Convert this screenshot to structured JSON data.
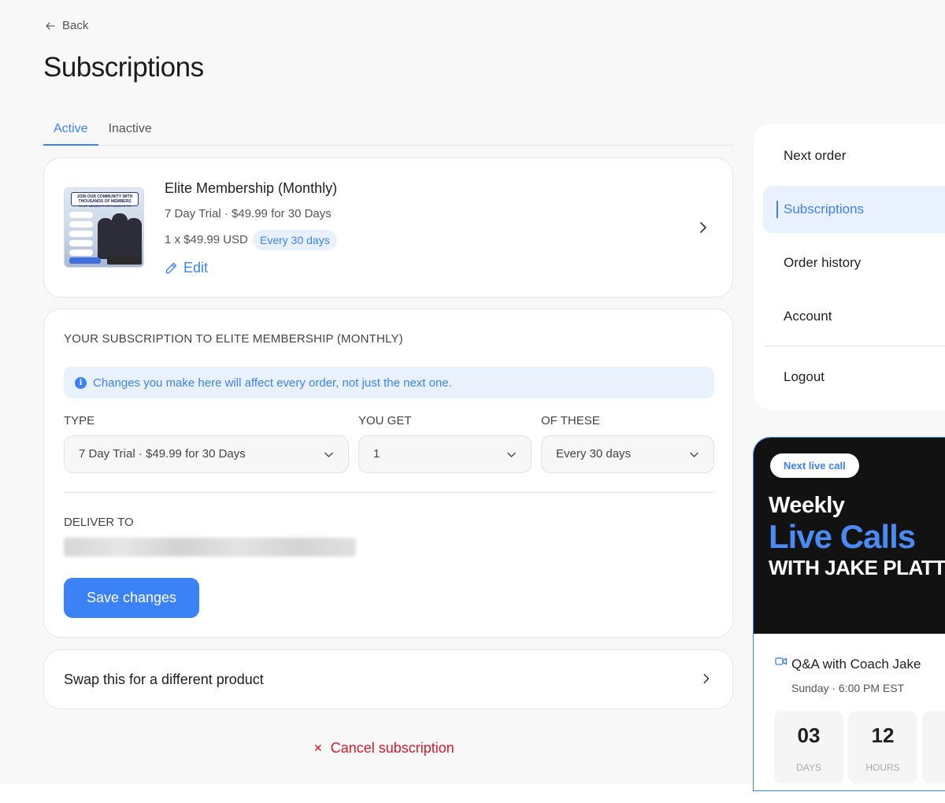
{
  "header": {
    "back_label": "Back",
    "page_title": "Subscriptions"
  },
  "tabs": [
    {
      "label": "Active",
      "active": true
    },
    {
      "label": "Inactive",
      "active": false
    }
  ],
  "product": {
    "name": "Elite Membership (Monthly)",
    "description": "7 Day Trial · $49.99 for 30 Days",
    "price_line": "1 x $49.99 USD",
    "frequency_badge": "Every 30 days",
    "edit_label": "Edit",
    "thumbnail": {
      "headline": "JOIN OUR COMMUNITY WITH THOUSANDS OF MEMBERS",
      "subline": "WHAT MEMBERS GET ACCESS TO"
    }
  },
  "details": {
    "section_title": "YOUR SUBSCRIPTION TO ELITE MEMBERSHIP (MONTHLY)",
    "notice": "Changes you make here will affect every order, not just the next one.",
    "type_label": "TYPE",
    "type_value": "7 Day Trial · $49.99 for 30 Days",
    "quantity_label": "YOU GET",
    "quantity_value": "1",
    "frequency_label": "OF THESE",
    "frequency_value": "Every 30 days",
    "deliver_label": "DELIVER TO",
    "save_label": "Save changes"
  },
  "swap": {
    "label": "Swap this for a different product"
  },
  "cancel": {
    "label": "Cancel subscription"
  },
  "side_nav": {
    "items": [
      {
        "label": "Next order",
        "active": false
      },
      {
        "label": "Subscriptions",
        "active": true
      },
      {
        "label": "Order history",
        "active": false
      },
      {
        "label": "Account",
        "active": false
      },
      {
        "label": "Logout",
        "active": false
      }
    ]
  },
  "live_call": {
    "pill": "Next live call",
    "headline_1": "Weekly",
    "headline_2": "Live Calls",
    "headline_3": "WITH JAKE PLATT",
    "call_title": "Q&A with Coach Jake",
    "call_time": "Sunday · 6:00 PM EST",
    "countdown": [
      {
        "value": "03",
        "unit": "DAYS"
      },
      {
        "value": "12",
        "unit": "HOURS"
      }
    ]
  },
  "colors": {
    "accent": "#3b82f6",
    "danger": "#d11a2a",
    "page_bg": "#f8f8f8"
  }
}
